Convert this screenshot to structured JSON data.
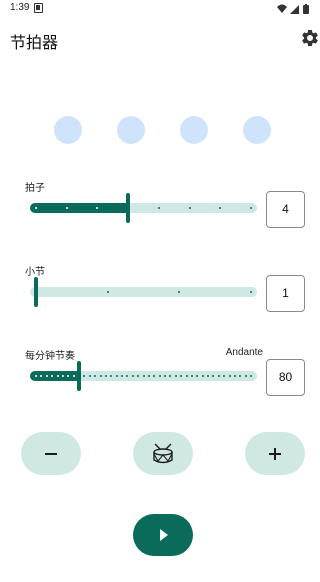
{
  "status": {
    "time": "1:39"
  },
  "app": {
    "title": "节拍器"
  },
  "beats": {
    "count": 4
  },
  "sections": {
    "beats_per_bar": {
      "label": "拍子",
      "value": "4",
      "min": 1,
      "max": 8,
      "current": 4
    },
    "bars": {
      "label": "小节",
      "value": "1",
      "min": 1,
      "max": 4,
      "current": 1
    },
    "bpm": {
      "label": "每分钟节奏",
      "tempo_name": "Andante",
      "value": "80",
      "min": 40,
      "max": 240,
      "current": 80
    }
  },
  "controls": {
    "decrease_icon": "minus-icon",
    "drum_icon": "drum-icon",
    "increase_icon": "plus-icon",
    "play_icon": "play-icon"
  },
  "colors": {
    "accent": "#0b6b5a",
    "track": "#cfe8e4",
    "beat_dot": "#cfe4fb"
  }
}
